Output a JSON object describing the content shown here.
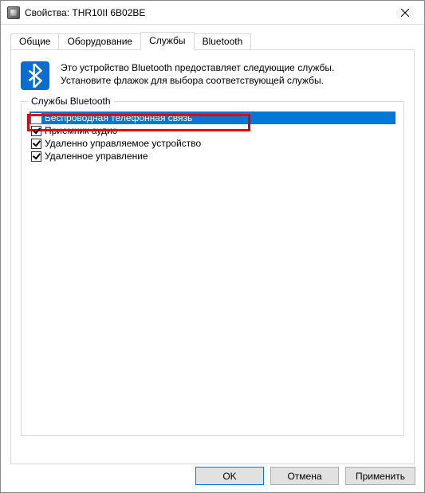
{
  "title": "Свойства: THR10II 6B02BE",
  "tabs": {
    "general": "Общие",
    "hardware": "Оборудование",
    "services": "Службы",
    "bluetooth": "Bluetooth"
  },
  "info": {
    "line1": "Это устройство Bluetooth предоставляет следующие службы.",
    "line2": "Установите флажок для выбора соответствующей службы."
  },
  "groupbox": {
    "legend": "Службы Bluetooth"
  },
  "services": [
    {
      "label": "Беспроводная телефонная связь",
      "checked": false,
      "highlighted": true
    },
    {
      "label": "Приемник аудио",
      "checked": true,
      "highlighted": false
    },
    {
      "label": "Удаленно управляемое устройство",
      "checked": true,
      "highlighted": false
    },
    {
      "label": "Удаленное управление",
      "checked": true,
      "highlighted": false
    }
  ],
  "buttons": {
    "ok": "OK",
    "cancel": "Отмена",
    "apply": "Применить"
  }
}
